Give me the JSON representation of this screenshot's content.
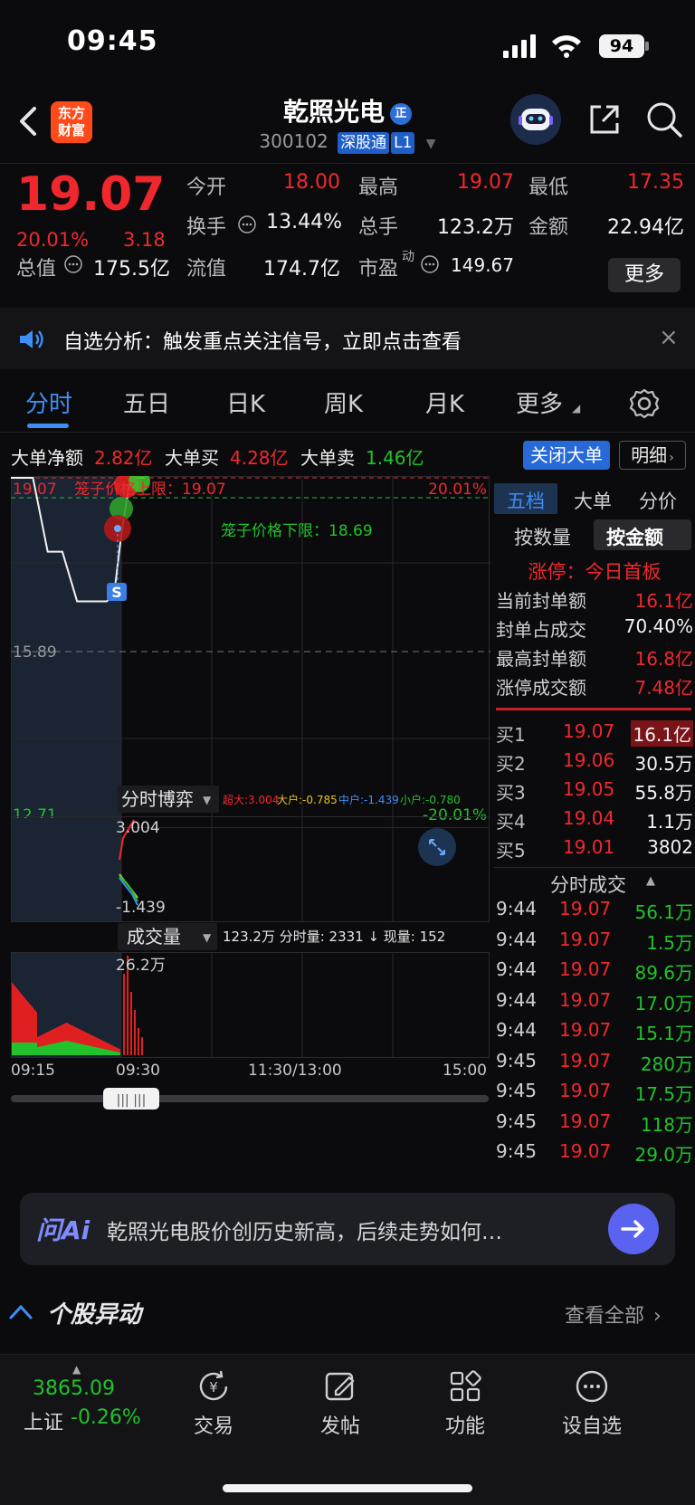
{
  "status_bar": {
    "time": "09:45",
    "battery": "94"
  },
  "header": {
    "brand_logo_line1": "东方",
    "brand_logo_line2": "财富",
    "stock_name": "乾照光电",
    "name_badge": "正",
    "stock_code": "300102",
    "market_tag": "深股通",
    "level_tag": "L1"
  },
  "quote": {
    "price": "19.07",
    "change_pct": "20.01%",
    "change_amt": "3.18",
    "open_label": "今开",
    "open_value": "18.00",
    "high_label": "最高",
    "high_value": "19.07",
    "low_label": "最低",
    "low_value": "17.35",
    "turnover_label": "换手",
    "turnover_value": "13.44%",
    "volume_label": "总手",
    "volume_value": "123.2万",
    "amount_label": "金额",
    "amount_value": "22.94亿",
    "mktcap_label": "总值",
    "mktcap_value": "175.5亿",
    "float_label": "流值",
    "float_value": "174.7亿",
    "pe_label": "市盈",
    "pe_sup": "动",
    "pe_value": "149.67",
    "more_button": "更多"
  },
  "notice": {
    "text": "自选分析：触发重点关注信号，立即点击查看"
  },
  "tabs": [
    "分时",
    "五日",
    "日K",
    "周K",
    "月K",
    "更多"
  ],
  "big_order": {
    "net_label": "大单净额",
    "net_value": "2.82亿",
    "buy_label": "大单买",
    "buy_value": "4.28亿",
    "sell_label": "大单卖",
    "sell_value": "1.46亿",
    "close_button": "关闭大单",
    "detail_button": "明细"
  },
  "chart_data": {
    "type": "line",
    "price_axis": {
      "top": "19.07",
      "mid": "15.89",
      "bottom": "12.71",
      "top_pct": "20.01%",
      "bottom_pct": "-20.01%"
    },
    "cage_upper_label": "笼子价格上限：19.07",
    "cage_lower_label": "笼子价格下限：18.69",
    "sell_marker": "S",
    "series": [
      {
        "x": [
          "09:15",
          "09:18",
          "09:20",
          "09:22",
          "09:24",
          "09:25",
          "09:26",
          "09:27",
          "09:28",
          "09:29",
          "09:30",
          "09:35",
          "09:40",
          "09:45"
        ],
        "values": [
          19.07,
          19.07,
          17.7,
          17.7,
          16.8,
          16.8,
          16.8,
          16.8,
          16.8,
          16.9,
          18.0,
          18.9,
          19.07,
          19.07
        ]
      }
    ],
    "x_ticks": [
      "09:15",
      "09:30",
      "11:30/13:00",
      "15:00"
    ],
    "game_panel": {
      "title": "分时博弈",
      "super_large": "超大:3.004",
      "large": "大户:-0.785",
      "medium": "中户:-1.439",
      "small": "小户:-0.780",
      "top_value": "3.004",
      "bottom_value": "-1.439"
    },
    "volume_panel": {
      "title": "成交量",
      "info": "123.2万 分时量: 2331 ↓ 现量: 152",
      "max_label": "26.2万"
    }
  },
  "right_panel": {
    "tabs": [
      "五档",
      "大单",
      "分价"
    ],
    "toggle": [
      "按数量",
      "按金额"
    ],
    "limit_title": "涨停：今日首板",
    "stats": [
      {
        "label": "当前封单额",
        "value": "16.1亿"
      },
      {
        "label": "封单占成交",
        "value": "70.40%"
      },
      {
        "label": "最高封单额",
        "value": "16.8亿"
      },
      {
        "label": "涨停成交额",
        "value": "7.48亿"
      }
    ],
    "order_book": [
      {
        "label": "买1",
        "price": "19.07",
        "qty": "16.1亿"
      },
      {
        "label": "买2",
        "price": "19.06",
        "qty": "30.5万"
      },
      {
        "label": "买3",
        "price": "19.05",
        "qty": "55.8万"
      },
      {
        "label": "买4",
        "price": "19.04",
        "qty": "1.1万"
      },
      {
        "label": "买5",
        "price": "19.01",
        "qty": "3802"
      }
    ],
    "ticks_title": "分时成交",
    "ticks": [
      {
        "time": "9:44",
        "price": "19.07",
        "qty": "56.1万"
      },
      {
        "time": "9:44",
        "price": "19.07",
        "qty": "1.5万"
      },
      {
        "time": "9:44",
        "price": "19.07",
        "qty": "89.6万"
      },
      {
        "time": "9:44",
        "price": "19.07",
        "qty": "17.0万"
      },
      {
        "time": "9:44",
        "price": "19.07",
        "qty": "15.1万"
      },
      {
        "time": "9:45",
        "price": "19.07",
        "qty": "280万"
      },
      {
        "time": "9:45",
        "price": "19.07",
        "qty": "17.5万"
      },
      {
        "time": "9:45",
        "price": "19.07",
        "qty": "118万"
      },
      {
        "time": "9:45",
        "price": "19.07",
        "qty": "29.0万"
      }
    ]
  },
  "ai_bar": {
    "logo": "问Ai",
    "prompt": "乾照光电股价创历史新高，后续走势如何…"
  },
  "movement": {
    "title": "个股异动",
    "view_all": "查看全部"
  },
  "bottom_nav": {
    "index_value": "3865.09",
    "index_name": "上证",
    "index_change": "-0.26%",
    "items": [
      "交易",
      "发帖",
      "功能",
      "设自选"
    ]
  },
  "colors": {
    "up": "#f0282d",
    "down": "#21c22c",
    "accent": "#3d8ef5"
  }
}
